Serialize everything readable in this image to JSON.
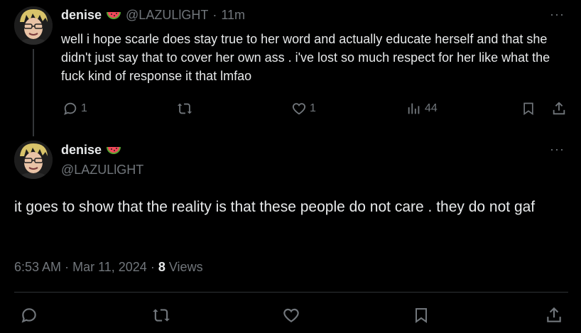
{
  "first_tweet": {
    "display_name": "denise",
    "emoji": "watermelon-emoji",
    "handle": "@LAZULlGHT",
    "separator": "·",
    "time": "11m",
    "more": "···",
    "text": "well i hope scarle does stay true to her word and actually educate herself and that she didn't just say that to cover her own ass . i've lost so much respect for her like what the fuck kind of response it that lmfao",
    "actions": {
      "replies": "1",
      "retweets": "",
      "likes": "1",
      "views": "44"
    }
  },
  "main_tweet": {
    "display_name": "denise",
    "emoji": "watermelon-emoji",
    "handle": "@LAZULlGHT",
    "more": "···",
    "text": "it goes to show that the reality is that these people do not care . they do not gaf",
    "time": "6:53 AM",
    "date": "Mar 11, 2024",
    "separator": "·",
    "views_count": "8",
    "views_label": "Views"
  },
  "colors": {
    "background": "#000000",
    "text": "#e7e9ea",
    "muted": "#71767b",
    "divider": "#2f3336",
    "watermelon_red": "#f2495a",
    "watermelon_green": "#5ba532"
  }
}
